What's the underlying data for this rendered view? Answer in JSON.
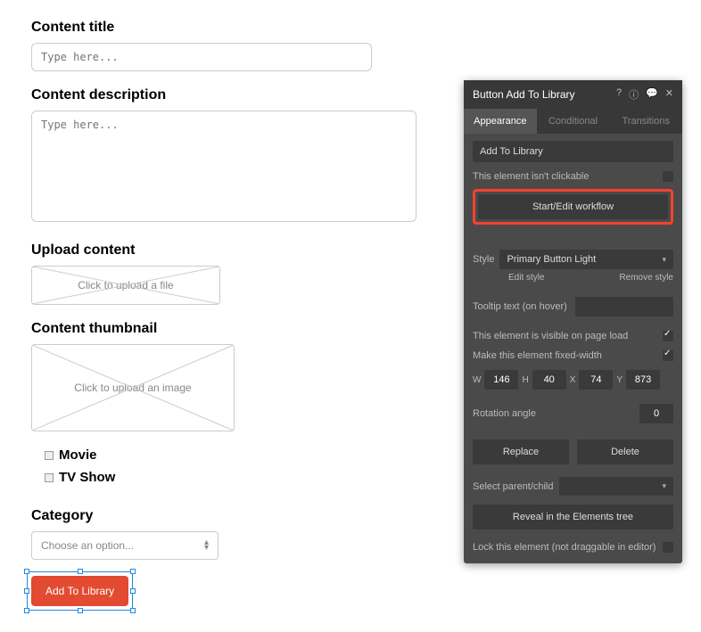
{
  "form": {
    "content_title_label": "Content title",
    "content_title_placeholder": "Type here...",
    "content_desc_label": "Content description",
    "content_desc_placeholder": "Type here...",
    "upload_content_label": "Upload content",
    "upload_content_text": "Click to upload a file",
    "thumbnail_label": "Content thumbnail",
    "thumbnail_text": "Click to upload an image",
    "checkbox_movie": "Movie",
    "checkbox_tvshow": "TV Show",
    "category_label": "Category",
    "category_placeholder": "Choose an option...",
    "add_button": "Add To Library"
  },
  "inspector": {
    "title": "Button Add To Library",
    "tabs": {
      "appearance": "Appearance",
      "conditional": "Conditional",
      "transitions": "Transitions"
    },
    "label_value": "Add To Library",
    "not_clickable": "This element isn't clickable",
    "workflow_btn": "Start/Edit workflow",
    "style_label": "Style",
    "style_value": "Primary Button Light",
    "edit_style": "Edit style",
    "remove_style": "Remove style",
    "tooltip_label": "Tooltip text (on hover)",
    "visible_label": "This element is visible on page load",
    "fixedwidth_label": "Make this element fixed-width",
    "dims": {
      "wl": "W",
      "w": "146",
      "hl": "H",
      "h": "40",
      "xl": "X",
      "x": "74",
      "yl": "Y",
      "y": "873"
    },
    "rotation_label": "Rotation angle",
    "rotation_value": "0",
    "replace": "Replace",
    "delete": "Delete",
    "select_parent": "Select parent/child",
    "reveal": "Reveal in the Elements tree",
    "lock": "Lock this element (not draggable in editor)"
  }
}
